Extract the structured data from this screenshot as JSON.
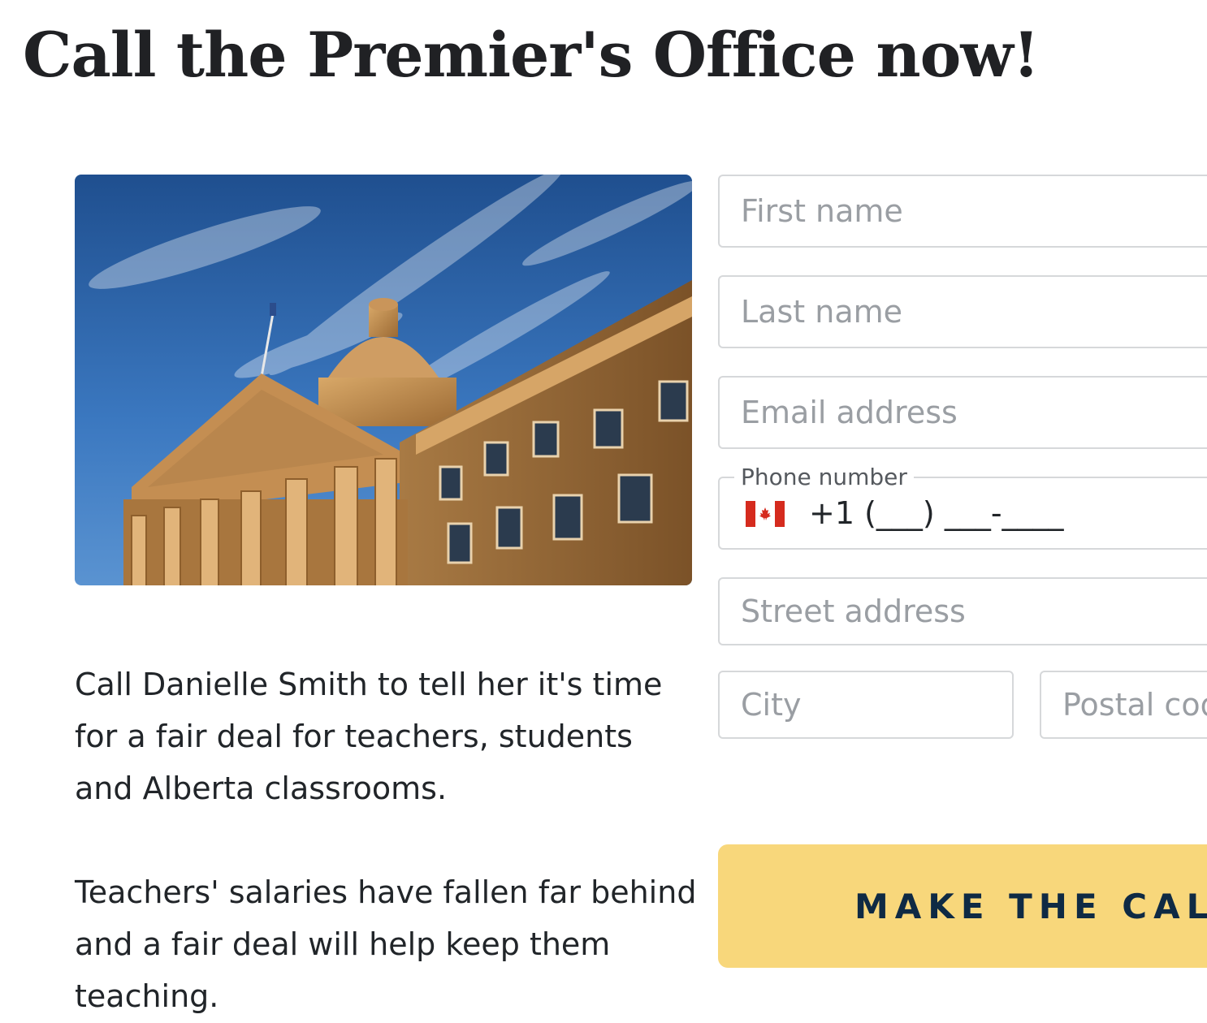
{
  "page": {
    "title": "Call the Premier's Office now!"
  },
  "hero_image": {
    "description_icon": "legislature-building-image"
  },
  "body": {
    "paragraph1": "Call Danielle Smith to tell her it's time for a fair deal for teachers, students and Alberta classrooms.",
    "paragraph2": "Teachers' salaries have fallen far behind and a fair deal will help keep them teaching."
  },
  "form": {
    "first_name": {
      "placeholder": "First name",
      "value": ""
    },
    "last_name": {
      "placeholder": "Last name",
      "value": ""
    },
    "email": {
      "placeholder": "Email address",
      "value": ""
    },
    "phone": {
      "label": "Phone number",
      "country_icon": "canada-flag-icon",
      "placeholder": "+1 (___) ___-____",
      "value": ""
    },
    "street": {
      "placeholder": "Street address",
      "value": ""
    },
    "city": {
      "placeholder": "City",
      "value": ""
    },
    "postal": {
      "placeholder": "Postal code",
      "value": ""
    },
    "submit_label": "MAKE THE CALL"
  },
  "colors": {
    "button_bg": "#f8d77b",
    "button_text": "#0f2a44",
    "text": "#212529",
    "placeholder": "#9a9ea3",
    "field_border": "#d6d8da",
    "flag_red": "#d52b1e"
  }
}
